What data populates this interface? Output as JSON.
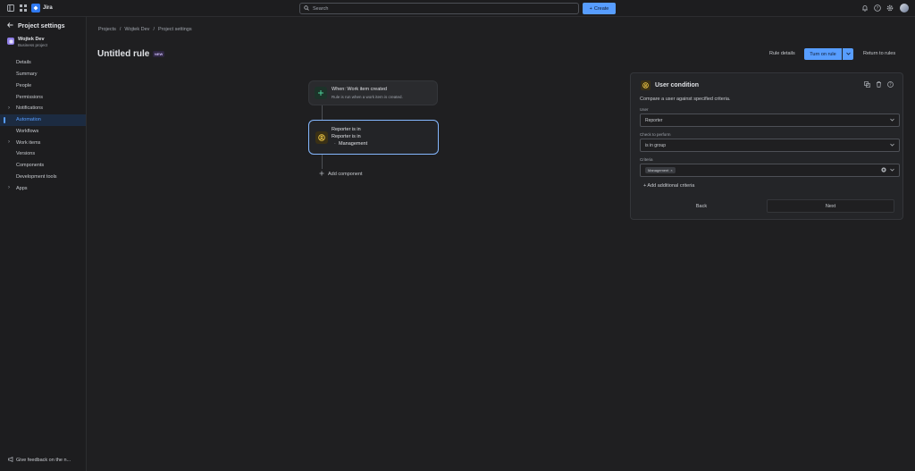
{
  "app": {
    "name": "Jira"
  },
  "search": {
    "placeholder": "Search"
  },
  "topbar": {
    "create_label": "Create"
  },
  "sidebar": {
    "heading": "Project settings",
    "project_name": "Wojtek Dev",
    "project_type": "Business project",
    "items": [
      {
        "label": "Details",
        "expandable": false,
        "active": false
      },
      {
        "label": "Summary",
        "expandable": false,
        "active": false
      },
      {
        "label": "People",
        "expandable": false,
        "active": false
      },
      {
        "label": "Permissions",
        "expandable": false,
        "active": false
      },
      {
        "label": "Notifications",
        "expandable": true,
        "active": false
      },
      {
        "label": "Automation",
        "expandable": false,
        "active": true
      },
      {
        "label": "Workflows",
        "expandable": false,
        "active": false
      },
      {
        "label": "Work items",
        "expandable": true,
        "active": false
      },
      {
        "label": "Versions",
        "expandable": false,
        "active": false
      },
      {
        "label": "Components",
        "expandable": false,
        "active": false
      },
      {
        "label": "Development tools",
        "expandable": false,
        "active": false
      },
      {
        "label": "Apps",
        "expandable": true,
        "active": false
      }
    ],
    "feedback": "Give feedback on the n..."
  },
  "breadcrumb": [
    "Projects",
    "Wojtek Dev",
    "Project settings"
  ],
  "breadcrumb_separator": "/",
  "page": {
    "title": "Untitled rule",
    "badge": "NEW",
    "rule_details": "Rule details",
    "turn_on": "Turn on rule",
    "return": "Return to rules"
  },
  "rule": {
    "trigger": {
      "title": "When: Work item created",
      "subtitle": "Rule is run when a work item is created."
    },
    "condition": {
      "title": "Reporter is in",
      "line2": "Reporter is in",
      "line3": "Management",
      "line3_prefix": "-"
    },
    "add_component": "Add component"
  },
  "panel": {
    "title": "User condition",
    "description": "Compare a user against specified criteria.",
    "user_label": "User",
    "user_value": "Reporter",
    "check_label": "Check to perform",
    "check_value": "is in group",
    "criteria_label": "Criteria",
    "criteria_chip": "Management",
    "chip_remove": "×",
    "add_criteria": "+ Add additional criteria",
    "back": "Back",
    "next": "Next"
  },
  "colors": {
    "accent": "#579dff",
    "background": "#1f1f21",
    "selected_border": "#85b8ff"
  }
}
